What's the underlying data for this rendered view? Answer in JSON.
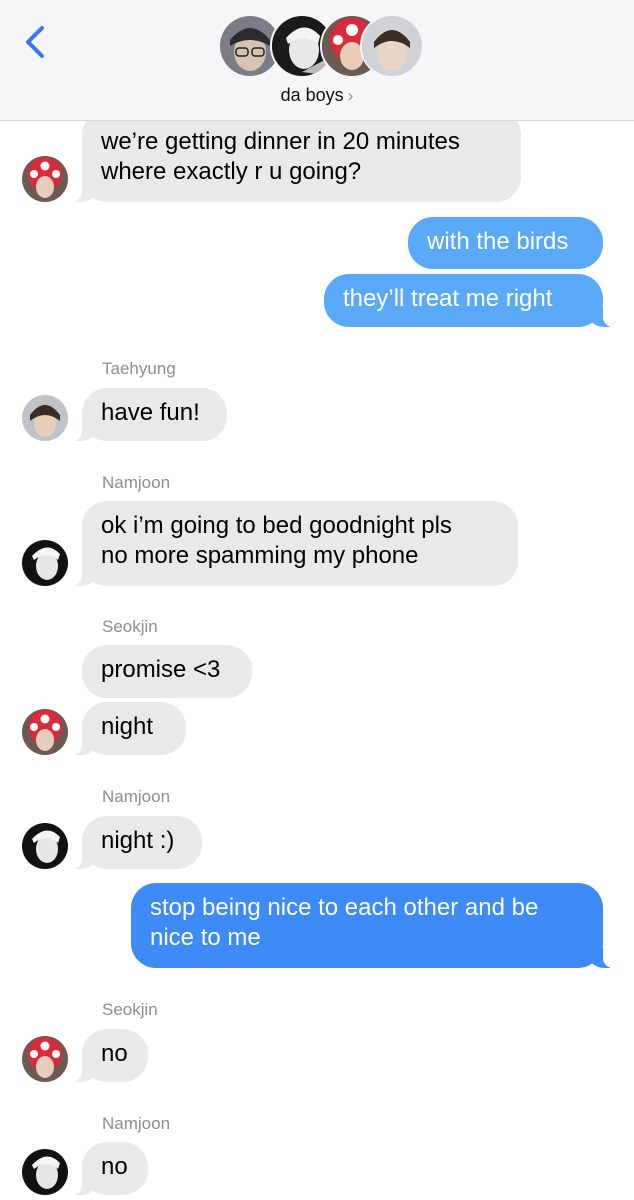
{
  "header": {
    "back_icon": "chevron-left-icon",
    "chat_name": "da boys",
    "chevron": "›",
    "accent": "#3478f6"
  },
  "messages": [
    {
      "side": "in",
      "text_lines": [
        "we’re getting dinner in 20 minutes",
        "where exactly r u going?"
      ],
      "avatar": "seokjin"
    },
    {
      "side": "out",
      "text_lines": [
        "with the birds"
      ]
    },
    {
      "side": "out",
      "text_lines": [
        "they’ll treat me right"
      ]
    },
    {
      "side": "in",
      "sender": "Taehyung",
      "text_lines": [
        "have fun!"
      ],
      "avatar": "taehyung"
    },
    {
      "side": "in",
      "sender": "Namjoon",
      "text_lines": [
        "ok i’m going to bed goodnight pls",
        "no more spamming my phone"
      ],
      "avatar": "namjoon"
    },
    {
      "side": "in",
      "sender": "Seokjin",
      "text_lines": [
        "promise <3"
      ]
    },
    {
      "side": "in",
      "text_lines": [
        "night"
      ],
      "avatar": "seokjin"
    },
    {
      "side": "in",
      "sender": "Namjoon",
      "text_lines": [
        "night :)"
      ],
      "avatar": "namjoon"
    },
    {
      "side": "out",
      "text_lines": [
        "stop being nice to each other and be",
        "nice to me"
      ]
    },
    {
      "side": "in",
      "sender": "Seokjin",
      "text_lines": [
        "no"
      ],
      "avatar": "seokjin"
    },
    {
      "side": "in",
      "sender": "Namjoon",
      "text_lines": [
        "no"
      ],
      "avatar": "namjoon"
    }
  ],
  "colors": {
    "incoming_bubble": "#e9e9eb",
    "outgoing_bubble": "#3d8bf7",
    "sender_name": "#8e8e93"
  }
}
